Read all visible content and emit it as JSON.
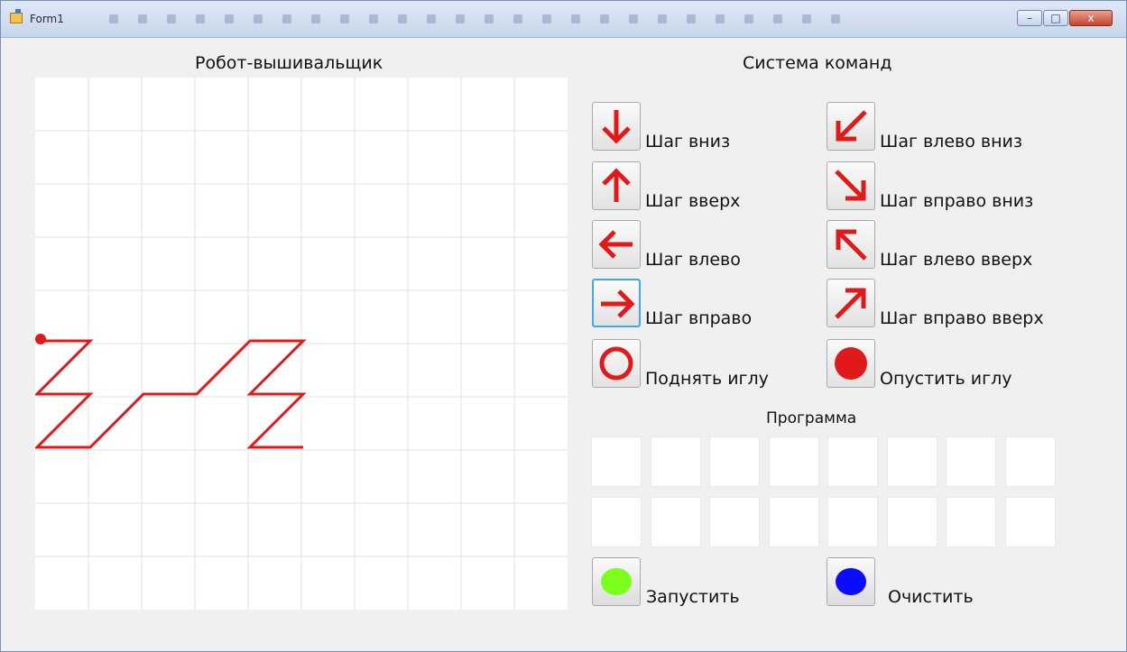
{
  "window": {
    "title": "Form1",
    "minimize": "–",
    "maximize": "□",
    "close": "x"
  },
  "colors": {
    "stitch": "#e01a1a",
    "start_button": "#7cff1a",
    "clear_button": "#0b0bff",
    "grid_line": "#e1e1e1"
  },
  "canvas": {
    "title": "Робот-вышивальщик",
    "grid": {
      "columns": 10,
      "rows": 10
    },
    "needle_start": {
      "col": 0,
      "row": 5
    },
    "stitch_path": [
      [
        0,
        5
      ],
      [
        1,
        5
      ],
      [
        0,
        6
      ],
      [
        1,
        6
      ],
      [
        0,
        7
      ],
      [
        1,
        7
      ],
      [
        2,
        6
      ],
      [
        3,
        6
      ],
      [
        4,
        5
      ],
      [
        5,
        5
      ],
      [
        4,
        6
      ],
      [
        5,
        6
      ],
      [
        4,
        7
      ],
      [
        5,
        7
      ]
    ]
  },
  "commands": {
    "title": "Система команд",
    "items": [
      {
        "label": "Шаг вниз",
        "icon": "arrow-down-icon"
      },
      {
        "label": "Шаг влево вниз",
        "icon": "arrow-down-left-icon"
      },
      {
        "label": "Шаг вверх",
        "icon": "arrow-up-icon"
      },
      {
        "label": "Шаг вправо вниз",
        "icon": "arrow-down-right-icon"
      },
      {
        "label": "Шаг влево",
        "icon": "arrow-left-icon"
      },
      {
        "label": "Шаг влево вверх",
        "icon": "arrow-up-left-icon"
      },
      {
        "label": "Шаг вправо",
        "icon": "arrow-right-icon"
      },
      {
        "label": "Шаг вправо вверх",
        "icon": "arrow-up-right-icon"
      },
      {
        "label": "Поднять иглу",
        "icon": "needle-up-circle-icon"
      },
      {
        "label": "Опустить иглу",
        "icon": "needle-down-dot-icon"
      }
    ]
  },
  "program": {
    "title": "Программа",
    "slots_per_row": 8,
    "rows": 2
  },
  "actions": {
    "run_label": "Запустить",
    "clear_label": "Очистить"
  }
}
